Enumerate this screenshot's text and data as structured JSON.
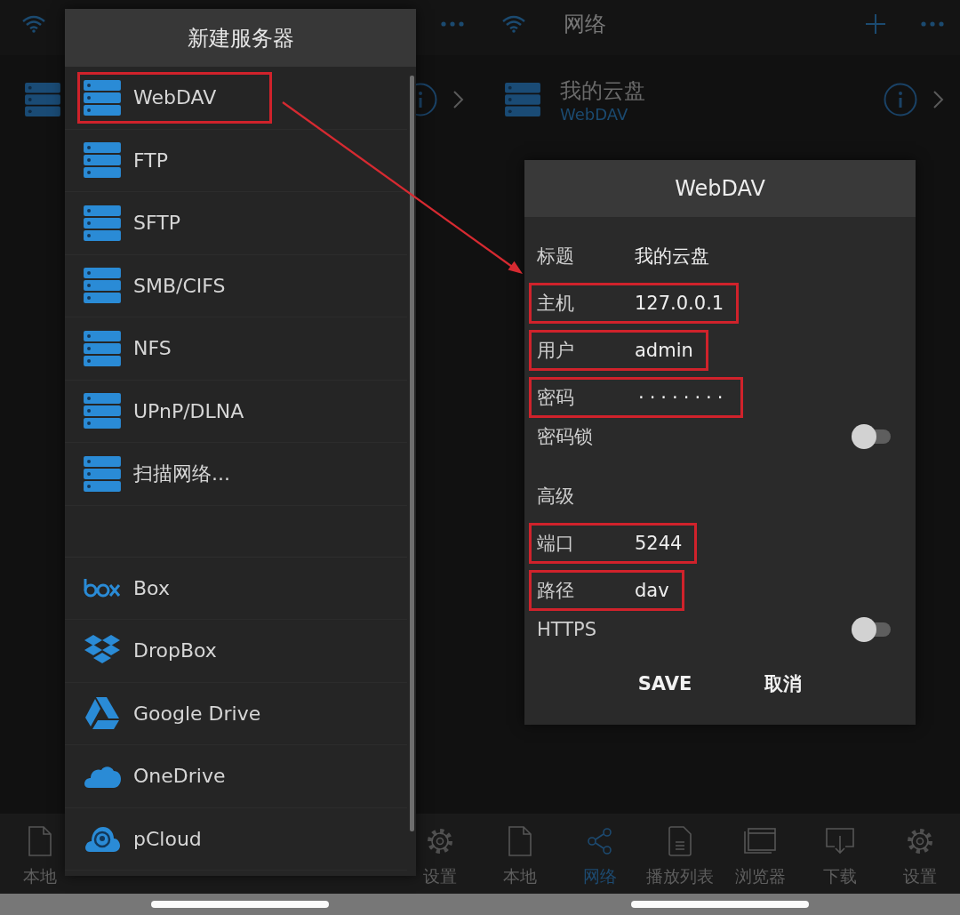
{
  "left_screen": {
    "nav_tabs": [
      {
        "label": "本地",
        "selected": false
      },
      {
        "label": "设置",
        "selected": false
      }
    ],
    "dialog": {
      "title": "新建服务器",
      "servers": [
        {
          "label": "WebDAV",
          "kind": "server",
          "highlighted": true
        },
        {
          "label": "FTP",
          "kind": "server",
          "highlighted": false
        },
        {
          "label": "SFTP",
          "kind": "server",
          "highlighted": false
        },
        {
          "label": "SMB/CIFS",
          "kind": "server",
          "highlighted": false
        },
        {
          "label": "NFS",
          "kind": "server",
          "highlighted": false
        },
        {
          "label": "UPnP/DLNA",
          "kind": "server",
          "highlighted": false
        },
        {
          "label": "扫描网络...",
          "kind": "server",
          "highlighted": false
        }
      ],
      "clouds": [
        {
          "label": "Box",
          "kind": "box"
        },
        {
          "label": "DropBox",
          "kind": "dropbox"
        },
        {
          "label": "Google Drive",
          "kind": "gdrive"
        },
        {
          "label": "OneDrive",
          "kind": "onedrive"
        },
        {
          "label": "pCloud",
          "kind": "pcloud"
        }
      ]
    }
  },
  "right_screen": {
    "title": "网络",
    "server": {
      "name": "我的云盘",
      "type": "WebDAV"
    },
    "nav_tabs": [
      {
        "label": "本地",
        "selected": false
      },
      {
        "label": "网络",
        "selected": true
      },
      {
        "label": "播放列表",
        "selected": false
      },
      {
        "label": "浏览器",
        "selected": false
      },
      {
        "label": "下载",
        "selected": false
      },
      {
        "label": "设置",
        "selected": false
      }
    ],
    "dialog": {
      "title": "WebDAV",
      "fields": [
        {
          "kind": "text",
          "label": "标题",
          "value": "我的云盘",
          "highlighted": false
        },
        {
          "kind": "text",
          "label": "主机",
          "value": "127.0.0.1",
          "highlighted": true
        },
        {
          "kind": "text",
          "label": "用户",
          "value": "admin",
          "highlighted": true
        },
        {
          "kind": "password",
          "label": "密码",
          "value": "········",
          "highlighted": true
        },
        {
          "kind": "toggle",
          "label": "密码锁",
          "on": false
        },
        {
          "kind": "heading",
          "label": "高级"
        },
        {
          "kind": "text",
          "label": "端口",
          "value": "5244",
          "highlighted": true
        },
        {
          "kind": "text",
          "label": "路径",
          "value": "dav",
          "highlighted": true
        },
        {
          "kind": "toggle",
          "label": "HTTPS",
          "on": false
        }
      ],
      "buttons": [
        "SAVE",
        "取消"
      ]
    }
  }
}
